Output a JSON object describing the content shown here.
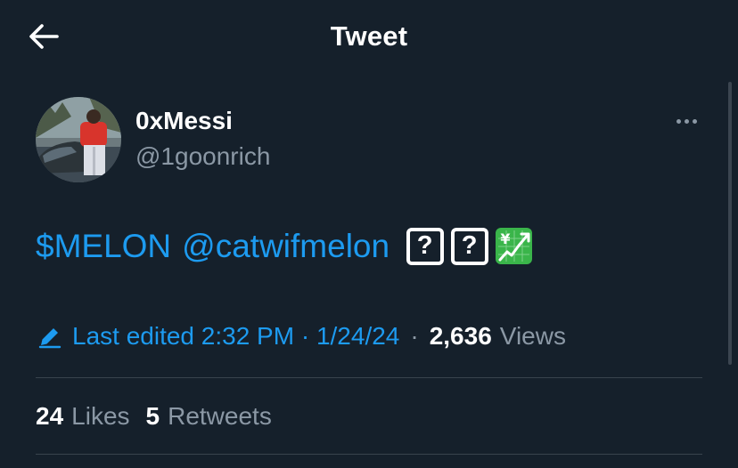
{
  "header": {
    "title": "Tweet",
    "back_icon": "arrow-left-icon"
  },
  "author": {
    "display_name": "0xMessi",
    "handle": "@1goonrich",
    "more_icon": "more-horizontal-icon"
  },
  "tweet": {
    "cashtag": "$MELON",
    "mention": "@catwifmelon",
    "emojis": [
      {
        "icon": "unknown-glyph-icon",
        "glyph": "?"
      },
      {
        "icon": "unknown-glyph-icon",
        "glyph": "?"
      },
      {
        "icon": "chart-increasing-with-yen-icon",
        "glyph": "¥"
      }
    ]
  },
  "meta": {
    "edit_icon": "pencil-icon",
    "edited_label": "Last edited",
    "time": "2:32 PM",
    "separator": "·",
    "date": "1/24/24",
    "views_count": "2,636",
    "views_label": "Views"
  },
  "stats": {
    "likes_count": "24",
    "likes_label": "Likes",
    "retweets_count": "5",
    "retweets_label": "Retweets"
  },
  "colors": {
    "background": "#15202b",
    "link": "#1d9bf0",
    "muted": "#8b98a5",
    "divider": "#38444d",
    "emoji_green": "#3ab54a"
  }
}
